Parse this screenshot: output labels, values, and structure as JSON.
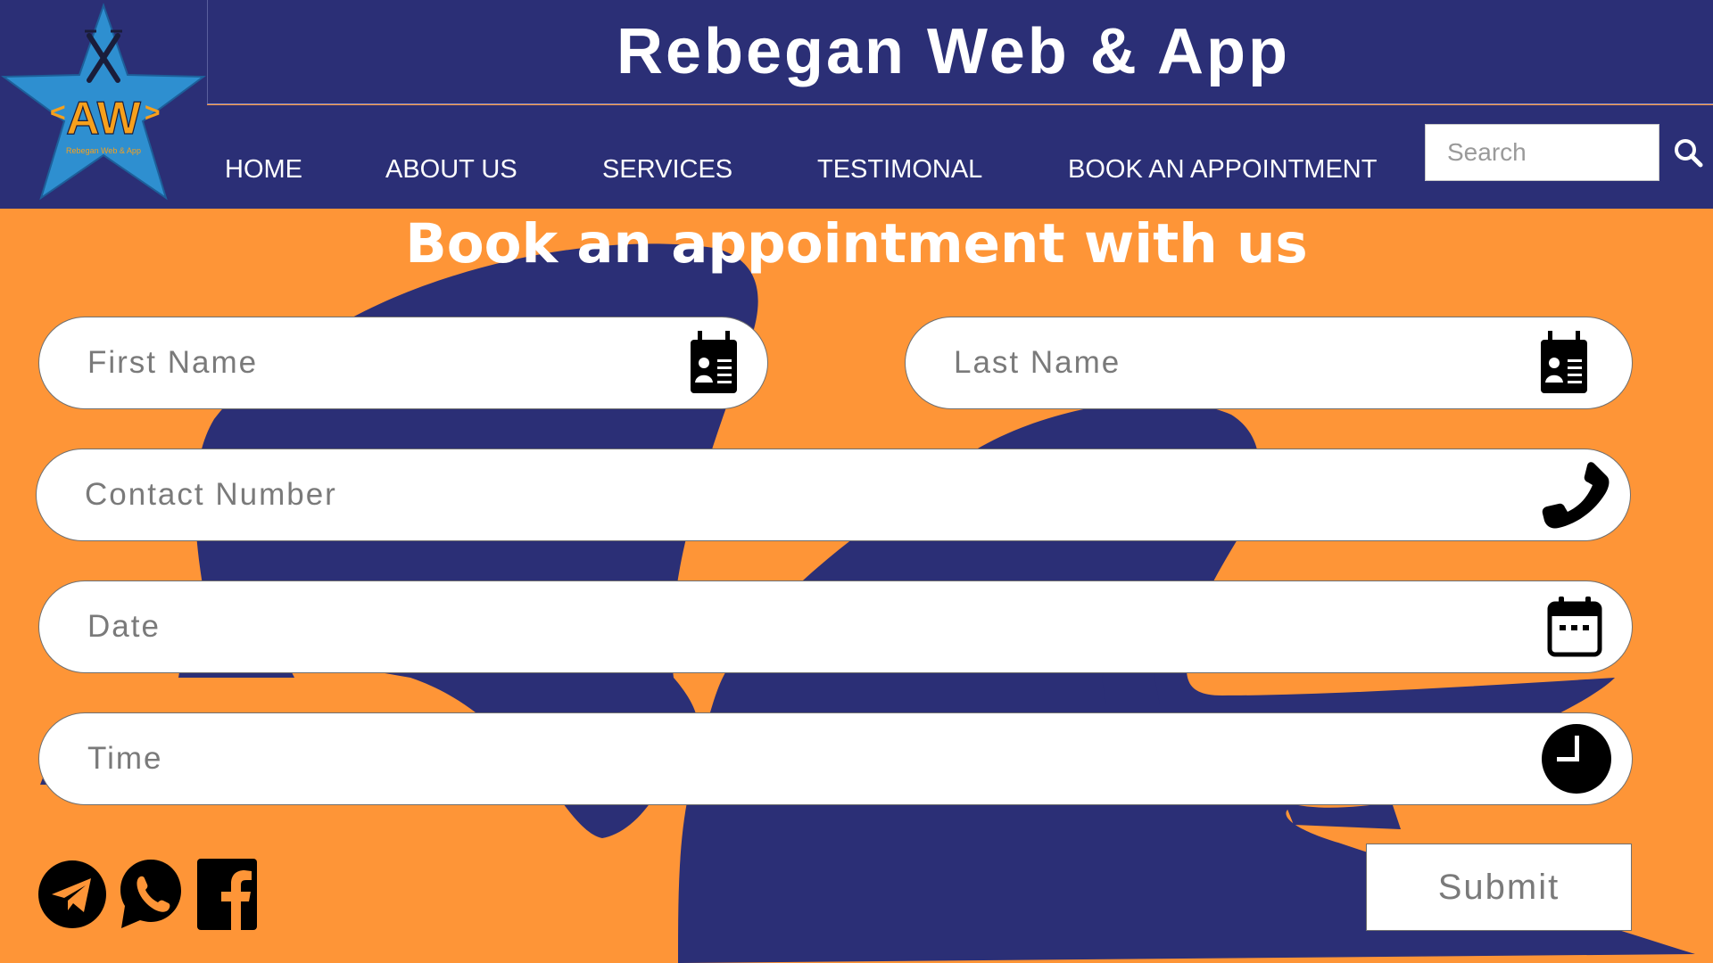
{
  "header": {
    "site_title": "Rebegan Web & App",
    "logo": {
      "mark": "AW",
      "name": "Rebegan Web & App"
    }
  },
  "nav": {
    "items": [
      {
        "label": "HOME"
      },
      {
        "label": "ABOUT US"
      },
      {
        "label": "SERVICES"
      },
      {
        "label": "TESTIMONAL"
      },
      {
        "label": "BOOK AN APPOINTMENT"
      }
    ],
    "search_placeholder": "Search"
  },
  "form": {
    "title": "Book an appointment with us",
    "fields": {
      "first_name": {
        "placeholder": "First Name",
        "icon": "contact-card-icon"
      },
      "last_name": {
        "placeholder": "Last Name",
        "icon": "contact-card-icon"
      },
      "contact_number": {
        "placeholder": "Contact Number",
        "icon": "phone-icon"
      },
      "date": {
        "placeholder": "Date",
        "icon": "calendar-icon"
      },
      "time": {
        "placeholder": "Time",
        "icon": "clock-icon"
      }
    },
    "submit_label": "Submit"
  },
  "social": [
    "telegram-icon",
    "whatsapp-icon",
    "facebook-icon"
  ],
  "colors": {
    "navy": "#2b2f76",
    "orange": "#fe9537",
    "logo_blue": "#2e8fd0",
    "logo_orange": "#f7a01c"
  }
}
